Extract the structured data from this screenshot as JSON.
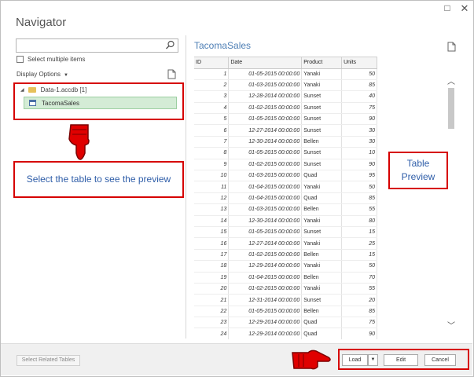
{
  "window": {
    "title": "Navigator",
    "maximize_glyph": "□",
    "close_glyph": "✕"
  },
  "left_panel": {
    "search": {
      "value": "",
      "placeholder": "",
      "icon": "search-icon"
    },
    "select_multiple_label": "Select multiple items",
    "display_options_label": "Display Options",
    "tree": {
      "database": "Data-1.accdb [1]",
      "table": "TacomaSales"
    }
  },
  "annotations": {
    "left_callout": "Select the table to see the preview",
    "right_callout": "Table Preview"
  },
  "preview": {
    "title": "TacomaSales",
    "columns": [
      "ID",
      "Date",
      "Product",
      "Units"
    ],
    "rows": [
      [
        "1",
        "01-05-2015 00:00:00",
        "Yanaki",
        "50"
      ],
      [
        "2",
        "01-03-2015 00:00:00",
        "Yanaki",
        "85"
      ],
      [
        "3",
        "12-28-2014 00:00:00",
        "Sunset",
        "40"
      ],
      [
        "4",
        "01-02-2015 00:00:00",
        "Sunset",
        "75"
      ],
      [
        "5",
        "01-05-2015 00:00:00",
        "Sunset",
        "90"
      ],
      [
        "6",
        "12-27-2014 00:00:00",
        "Sunset",
        "30"
      ],
      [
        "7",
        "12-30-2014 00:00:00",
        "Bellen",
        "30"
      ],
      [
        "8",
        "01-05-2015 00:00:00",
        "Sunset",
        "10"
      ],
      [
        "9",
        "01-02-2015 00:00:00",
        "Sunset",
        "90"
      ],
      [
        "10",
        "01-03-2015 00:00:00",
        "Quad",
        "95"
      ],
      [
        "11",
        "01-04-2015 00:00:00",
        "Yanaki",
        "50"
      ],
      [
        "12",
        "01-04-2015 00:00:00",
        "Quad",
        "85"
      ],
      [
        "13",
        "01-03-2015 00:00:00",
        "Bellen",
        "55"
      ],
      [
        "14",
        "12-30-2014 00:00:00",
        "Yanaki",
        "80"
      ],
      [
        "15",
        "01-05-2015 00:00:00",
        "Sunset",
        "15"
      ],
      [
        "16",
        "12-27-2014 00:00:00",
        "Yanaki",
        "25"
      ],
      [
        "17",
        "01-02-2015 00:00:00",
        "Bellen",
        "15"
      ],
      [
        "18",
        "12-29-2014 00:00:00",
        "Yanaki",
        "50"
      ],
      [
        "19",
        "01-04-2015 00:00:00",
        "Bellen",
        "70"
      ],
      [
        "20",
        "01-02-2015 00:00:00",
        "Yanaki",
        "55"
      ],
      [
        "21",
        "12-31-2014 00:00:00",
        "Sunset",
        "20"
      ],
      [
        "22",
        "01-05-2015 00:00:00",
        "Bellen",
        "85"
      ],
      [
        "23",
        "12-29-2014 00:00:00",
        "Quad",
        "75"
      ],
      [
        "24",
        "12-29-2014 00:00:00",
        "Quad",
        "90"
      ]
    ]
  },
  "footer": {
    "select_related_label": "Select Related Tables",
    "load_label": "Load",
    "edit_label": "Edit",
    "cancel_label": "Cancel"
  },
  "colors": {
    "highlight_red": "#d60000",
    "callout_text": "#2e5da8",
    "selected_row": "#d4ecd6"
  }
}
